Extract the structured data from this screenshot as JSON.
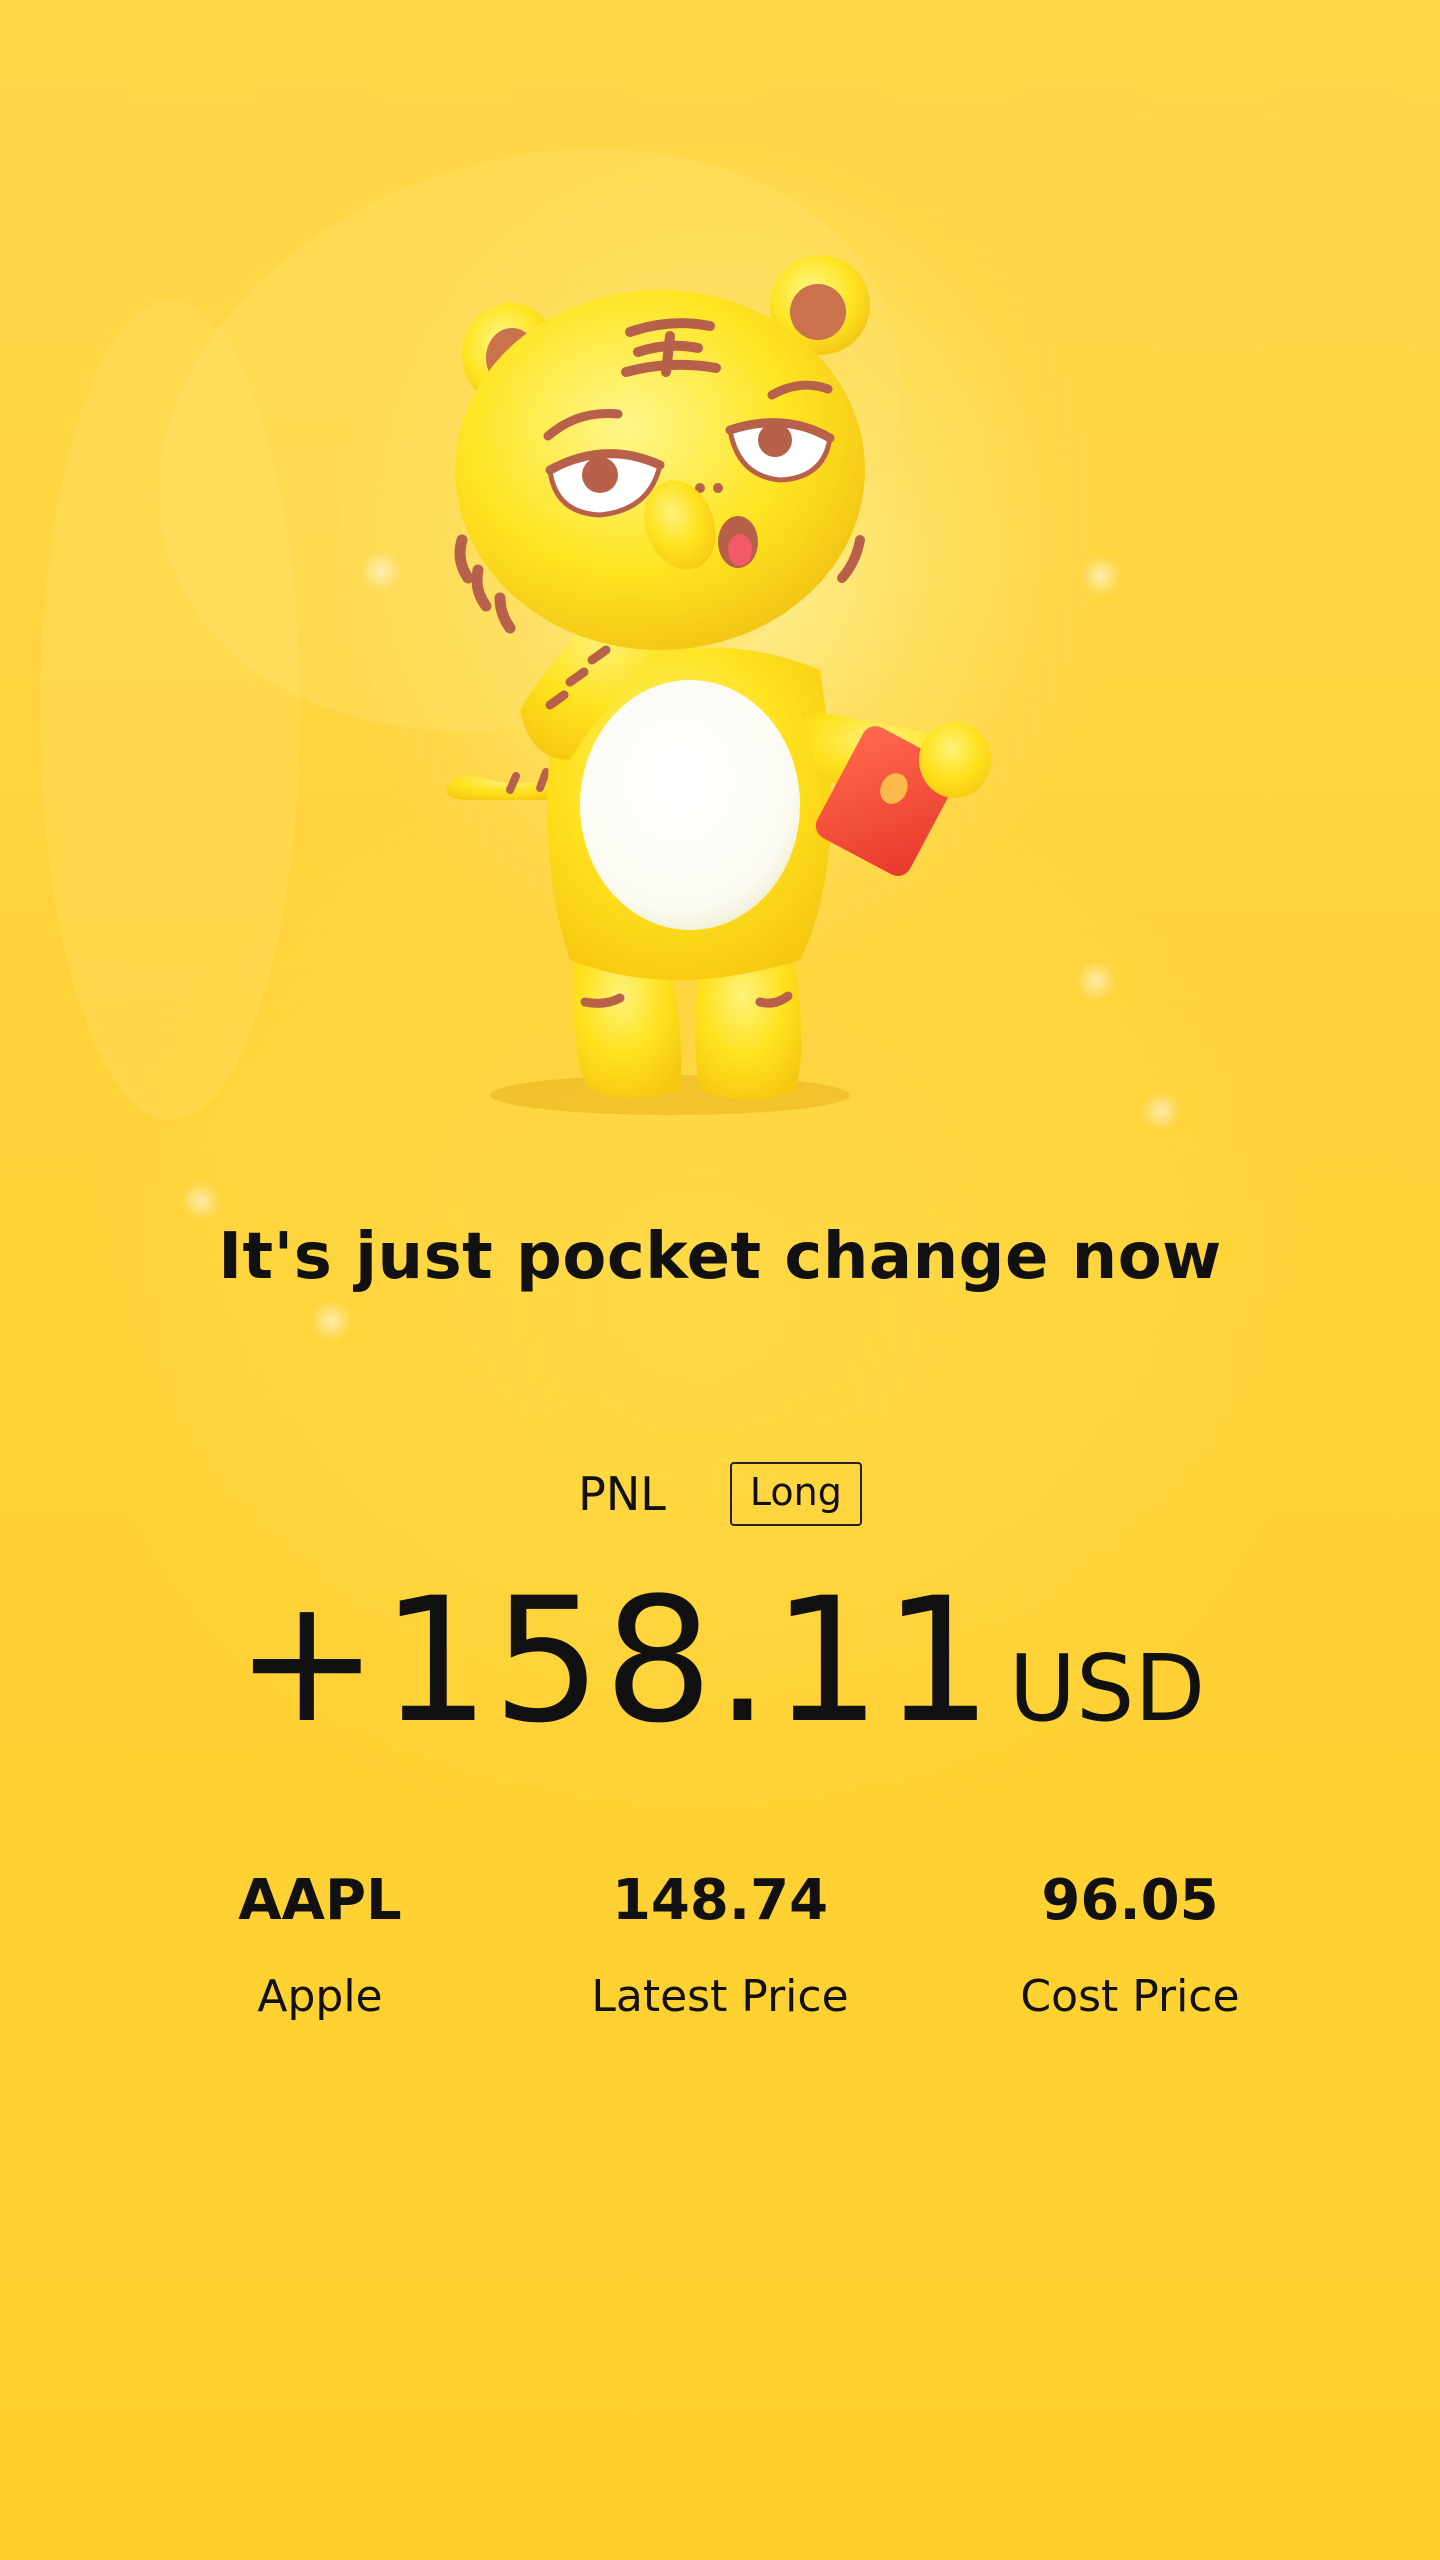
{
  "tagline": "It's just pocket change now",
  "pnl": {
    "label": "PNL",
    "direction": "Long",
    "amount": "+158.11",
    "currency": "USD"
  },
  "stats": [
    {
      "value": "AAPL",
      "label": "Apple"
    },
    {
      "value": "148.74",
      "label": "Latest Price"
    },
    {
      "value": "96.05",
      "label": "Cost Price"
    }
  ],
  "colors": {
    "background": "#ffd232",
    "text": "#111111",
    "mascot_body": "#ffe22a",
    "mascot_stripes": "#b8614a",
    "red_envelope": "#f24a3a"
  },
  "icons": {
    "mascot": "tiger-mascot-holding-red-envelope"
  }
}
